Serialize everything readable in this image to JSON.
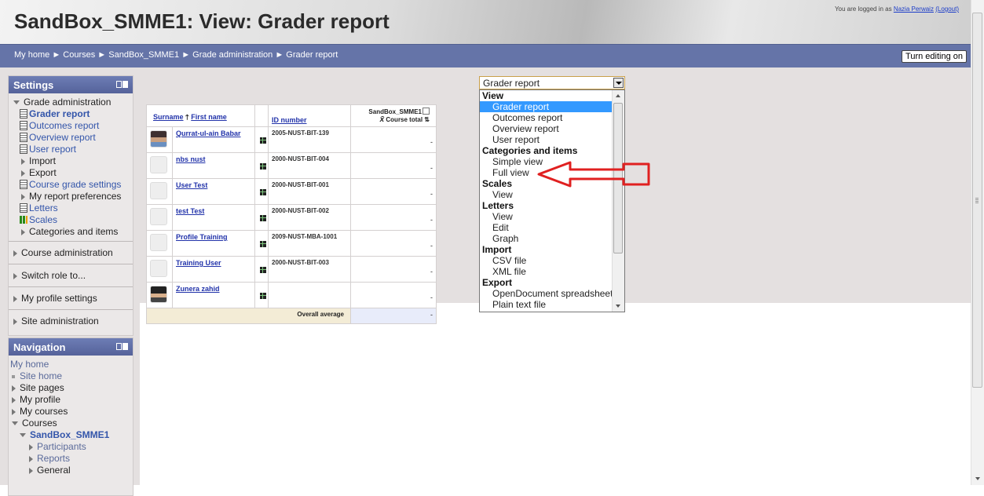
{
  "header": {
    "title": "SandBox_SMME1: View: Grader report",
    "logged_prefix": "You are logged in as ",
    "user": "Nazia Perwaiz",
    "logout": "(Logout)"
  },
  "breadcrumb": [
    "My home",
    "Courses",
    "SandBox_SMME1",
    "Grade administration",
    "Grader report"
  ],
  "breadcrumb_sep": "►",
  "turn_editing": "Turn editing on",
  "settings": {
    "title": "Settings",
    "grade_admin": "Grade administration",
    "grader_report": "Grader report",
    "outcomes_report": "Outcomes report",
    "overview_report": "Overview report",
    "user_report": "User report",
    "import": "Import",
    "export": "Export",
    "course_grade_settings": "Course grade settings",
    "my_report_prefs": "My report preferences",
    "letters": "Letters",
    "scales": "Scales",
    "categories_items": "Categories and items",
    "course_admin": "Course administration",
    "switch_role": "Switch role to...",
    "my_profile_settings": "My profile settings",
    "site_admin": "Site administration"
  },
  "navigation": {
    "title": "Navigation",
    "my_home": "My home",
    "site_home": "Site home",
    "site_pages": "Site pages",
    "my_profile": "My profile",
    "my_courses": "My courses",
    "courses": "Courses",
    "course": "SandBox_SMME1",
    "participants": "Participants",
    "reports": "Reports",
    "general": "General"
  },
  "grader": {
    "col_surname": "Surname",
    "col_firstname": "First name",
    "col_id": "ID number",
    "col_course": "SandBox_SMME1",
    "col_total": "Course total",
    "mean_symbol": "x̄",
    "rows": [
      {
        "name": "Qurrat-ul-ain Babar",
        "id": "2005-NUST-BIT-139",
        "total": "-",
        "photo": "photo"
      },
      {
        "name": "nbs nust",
        "id": "2000-NUST-BIT-004",
        "total": "-",
        "photo": ""
      },
      {
        "name": "User Test",
        "id": "2000-NUST-BIT-001",
        "total": "-",
        "photo": ""
      },
      {
        "name": "test Test",
        "id": "2000-NUST-BIT-002",
        "total": "-",
        "photo": ""
      },
      {
        "name": "Profile Training",
        "id": "2009-NUST-MBA-1001",
        "total": "-",
        "photo": ""
      },
      {
        "name": "Training User",
        "id": "2000-NUST-BIT-003",
        "total": "-",
        "photo": ""
      },
      {
        "name": "Zunera zahid",
        "id": "",
        "total": "-",
        "photo": "photo2"
      }
    ],
    "overall_label": "Overall average",
    "overall_value": "-"
  },
  "dropdown": {
    "selected": "Grader report",
    "options": [
      {
        "type": "group",
        "label": "View"
      },
      {
        "type": "opt",
        "label": "Grader report",
        "selected": true
      },
      {
        "type": "opt",
        "label": "Outcomes report"
      },
      {
        "type": "opt",
        "label": "Overview report"
      },
      {
        "type": "opt",
        "label": "User report"
      },
      {
        "type": "group",
        "label": "Categories and items"
      },
      {
        "type": "opt",
        "label": "Simple view"
      },
      {
        "type": "opt",
        "label": "Full view"
      },
      {
        "type": "group",
        "label": "Scales"
      },
      {
        "type": "opt",
        "label": "View"
      },
      {
        "type": "group",
        "label": "Letters"
      },
      {
        "type": "opt",
        "label": "View"
      },
      {
        "type": "opt",
        "label": "Edit"
      },
      {
        "type": "opt",
        "label": "Graph"
      },
      {
        "type": "group",
        "label": "Import"
      },
      {
        "type": "opt",
        "label": "CSV file"
      },
      {
        "type": "opt",
        "label": "XML file"
      },
      {
        "type": "group",
        "label": "Export"
      },
      {
        "type": "opt",
        "label": "OpenDocument spreadsheet"
      },
      {
        "type": "opt",
        "label": "Plain text file"
      }
    ]
  },
  "colors": {
    "navbar": "#6574a8",
    "highlight": "#3399ff",
    "annotation_arrow": "#e02020"
  }
}
